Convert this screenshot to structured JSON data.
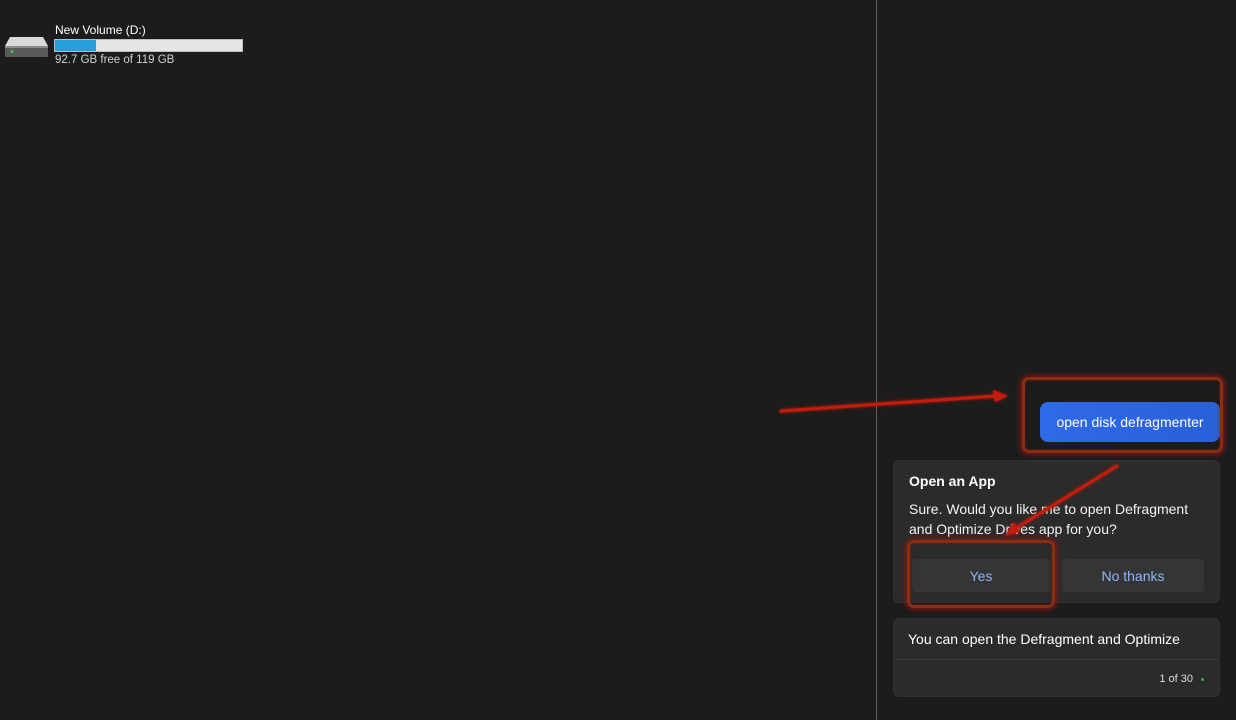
{
  "explorer": {
    "drive": {
      "icon": "hard-drive-icon",
      "name": "New Volume (D:)",
      "used_fraction": 0.22,
      "free_text": "92.7 GB free of 119 GB",
      "bar_color": "#26a0da"
    }
  },
  "chat": {
    "user_message": "open disk defragmenter",
    "response_card": {
      "title": "Open an App",
      "body": "Sure. Would you like me to open Defragment and Optimize Drives app for you?",
      "yes_label": "Yes",
      "no_label": "No thanks"
    },
    "followup_card": {
      "text": "You can open the Defragment and Optimize",
      "counter": "1 of 30"
    },
    "accent_color": "#2f6ae8"
  },
  "annotations": {
    "highlight_color": "#8a2e12",
    "arrow_color": "#c41a0f"
  }
}
